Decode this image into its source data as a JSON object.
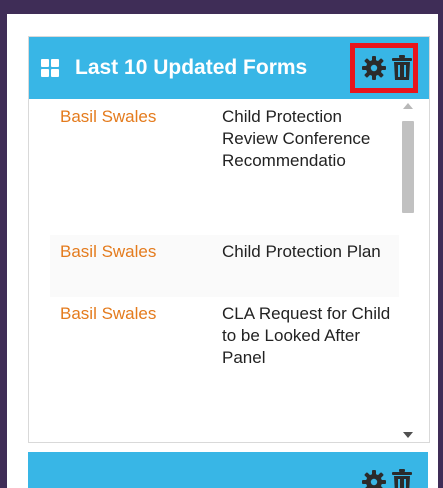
{
  "widget": {
    "title": "Last 10 Updated Forms",
    "icons": {
      "grid": "grid-icon",
      "settings": "gear-icon",
      "delete": "trash-icon"
    },
    "highlight_color": "#e8141c",
    "header_color": "#38b6e6",
    "items": [
      {
        "person": "Basil Swales",
        "form": "Child Protection Review Conference Recommendatio"
      },
      {
        "person": "Basil Swales",
        "form": "Child Protection Plan"
      },
      {
        "person": "Basil Swales",
        "form": "CLA Request for Child to be Looked After Panel"
      }
    ]
  },
  "widget2": {
    "icons": {
      "settings": "gear-icon",
      "delete": "trash-icon"
    }
  }
}
